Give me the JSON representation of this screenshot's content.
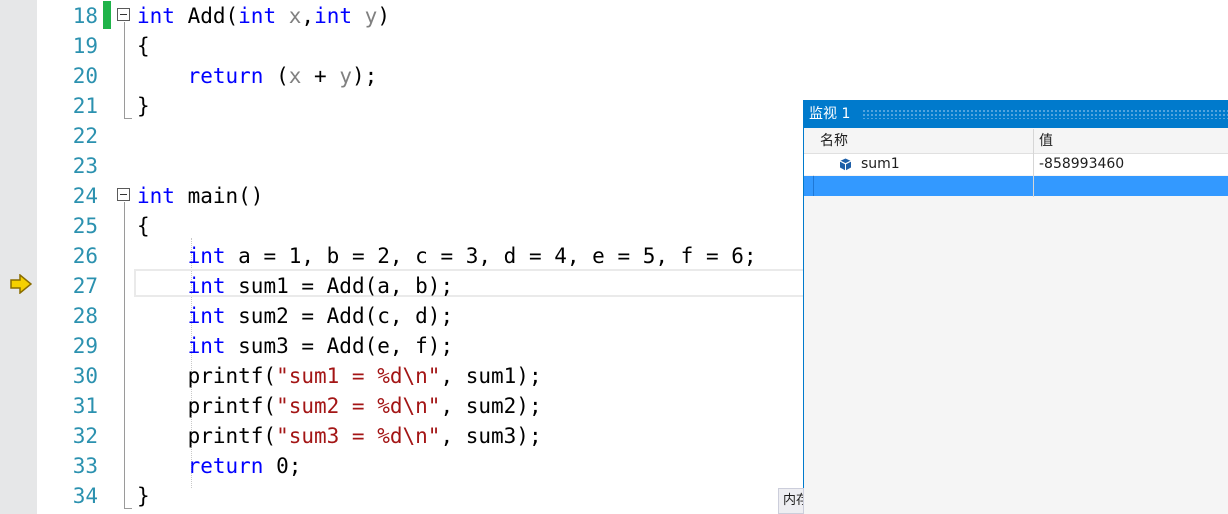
{
  "editor": {
    "current_line": "27",
    "lines": [
      {
        "num": "18",
        "tokens": [
          {
            "t": "int",
            "c": "kw"
          },
          {
            "t": " Add(",
            "c": ""
          },
          {
            "t": "int",
            "c": "kw"
          },
          {
            "t": " ",
            "c": ""
          },
          {
            "t": "x",
            "c": "param"
          },
          {
            "t": ",",
            "c": ""
          },
          {
            "t": "int",
            "c": "kw"
          },
          {
            "t": " ",
            "c": ""
          },
          {
            "t": "y",
            "c": "param"
          },
          {
            "t": ")",
            "c": ""
          }
        ]
      },
      {
        "num": "19",
        "tokens": [
          {
            "t": "{",
            "c": ""
          }
        ]
      },
      {
        "num": "20",
        "tokens": [
          {
            "t": "    ",
            "c": ""
          },
          {
            "t": "return",
            "c": "kw"
          },
          {
            "t": " (",
            "c": ""
          },
          {
            "t": "x",
            "c": "param"
          },
          {
            "t": " + ",
            "c": ""
          },
          {
            "t": "y",
            "c": "param"
          },
          {
            "t": ");",
            "c": ""
          }
        ]
      },
      {
        "num": "21",
        "tokens": [
          {
            "t": "}",
            "c": ""
          }
        ]
      },
      {
        "num": "22",
        "tokens": []
      },
      {
        "num": "23",
        "tokens": []
      },
      {
        "num": "24",
        "tokens": [
          {
            "t": "int",
            "c": "kw"
          },
          {
            "t": " main()",
            "c": ""
          }
        ]
      },
      {
        "num": "25",
        "tokens": [
          {
            "t": "{",
            "c": ""
          }
        ]
      },
      {
        "num": "26",
        "tokens": [
          {
            "t": "    ",
            "c": ""
          },
          {
            "t": "int",
            "c": "kw"
          },
          {
            "t": " a = 1, b = 2, c = 3, d = 4, e = 5, f = 6;",
            "c": ""
          }
        ]
      },
      {
        "num": "27",
        "tokens": [
          {
            "t": "    ",
            "c": ""
          },
          {
            "t": "int",
            "c": "kw"
          },
          {
            "t": " sum1 = Add(a, b);",
            "c": ""
          }
        ]
      },
      {
        "num": "28",
        "tokens": [
          {
            "t": "    ",
            "c": ""
          },
          {
            "t": "int",
            "c": "kw"
          },
          {
            "t": " sum2 = Add(c, d);",
            "c": ""
          }
        ]
      },
      {
        "num": "29",
        "tokens": [
          {
            "t": "    ",
            "c": ""
          },
          {
            "t": "int",
            "c": "kw"
          },
          {
            "t": " sum3 = Add(e, f);",
            "c": ""
          }
        ]
      },
      {
        "num": "30",
        "tokens": [
          {
            "t": "    printf(",
            "c": ""
          },
          {
            "t": "\"sum1 = %d\\n\"",
            "c": "str"
          },
          {
            "t": ", sum1);",
            "c": ""
          }
        ]
      },
      {
        "num": "31",
        "tokens": [
          {
            "t": "    printf(",
            "c": ""
          },
          {
            "t": "\"sum2 = %d\\n\"",
            "c": "str"
          },
          {
            "t": ", sum2);",
            "c": ""
          }
        ]
      },
      {
        "num": "32",
        "tokens": [
          {
            "t": "    printf(",
            "c": ""
          },
          {
            "t": "\"sum3 = %d\\n\"",
            "c": "str"
          },
          {
            "t": ", sum3);",
            "c": ""
          }
        ]
      },
      {
        "num": "33",
        "tokens": [
          {
            "t": "    ",
            "c": ""
          },
          {
            "t": "return",
            "c": "kw"
          },
          {
            "t": " 0;",
            "c": ""
          }
        ]
      },
      {
        "num": "34",
        "tokens": [
          {
            "t": "}",
            "c": ""
          }
        ]
      }
    ]
  },
  "watch": {
    "title": "监视 1",
    "col_name": "名称",
    "col_value": "值",
    "rows": [
      {
        "name": "sum1",
        "value": "-858993460",
        "icon": "variable-cube-icon"
      }
    ]
  },
  "bottom_tab": {
    "label": "内存"
  },
  "colors": {
    "keyword": "#0000ff",
    "string": "#a31515",
    "param": "#808080",
    "line_number": "#2b91af",
    "accent": "#007acc",
    "selection": "#3399ff",
    "change_bar": "#1fb34a",
    "exec_arrow": "#f5d000"
  }
}
